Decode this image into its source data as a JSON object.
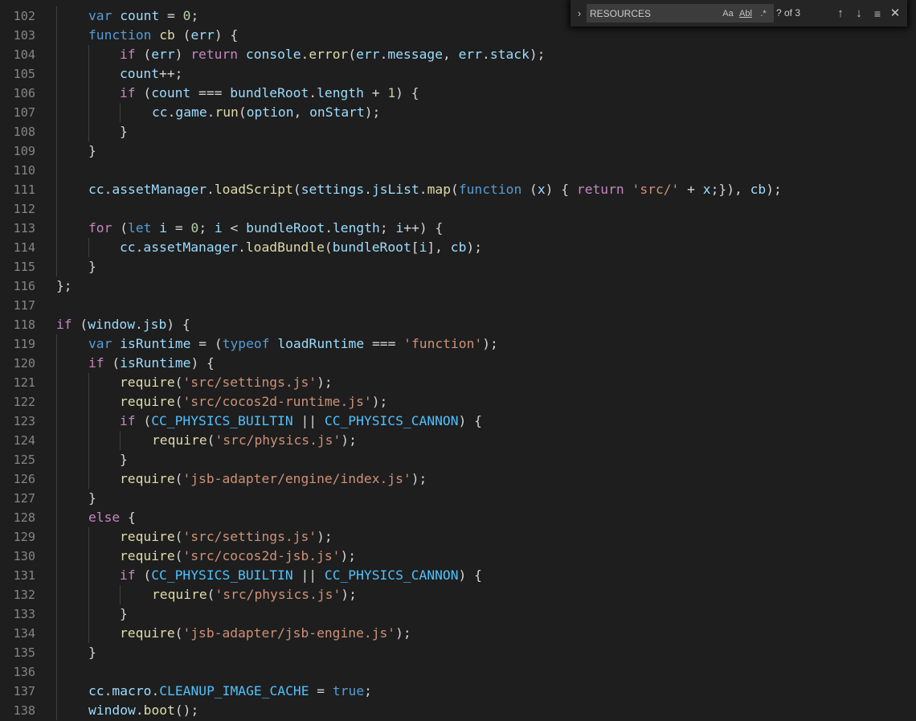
{
  "find": {
    "toggle_icon": "chevron-right",
    "query": "RESOURCES",
    "match_case_label": "Aa",
    "match_word_label": "Abl",
    "regex_label": ".*",
    "match_count": "? of 3",
    "prev_icon": "↑",
    "next_icon": "↓",
    "selection_icon": "≡",
    "close_icon": "✕"
  },
  "colors": {
    "background": "#1e1e1e",
    "keyword": "#569cd6",
    "control": "#c586c0",
    "variable": "#9cdcfe",
    "function": "#dcdcaa",
    "string": "#ce9178",
    "number": "#b5cea8",
    "constant": "#4fc1ff",
    "line_number": "#858585"
  },
  "lines": [
    {
      "n": "102",
      "indent": 1,
      "t": [
        [
          "kw",
          "var"
        ],
        [
          "pl",
          " "
        ],
        [
          "var",
          "count"
        ],
        [
          "pl",
          " = "
        ],
        [
          "num",
          "0"
        ],
        [
          "pl",
          ";"
        ]
      ]
    },
    {
      "n": "103",
      "indent": 1,
      "t": [
        [
          "kw",
          "function"
        ],
        [
          "pl",
          " "
        ],
        [
          "fn",
          "cb"
        ],
        [
          "pl",
          " ("
        ],
        [
          "var",
          "err"
        ],
        [
          "pl",
          ") {"
        ]
      ]
    },
    {
      "n": "104",
      "indent": 2,
      "t": [
        [
          "ctl",
          "if"
        ],
        [
          "pl",
          " ("
        ],
        [
          "var",
          "err"
        ],
        [
          "pl",
          ") "
        ],
        [
          "ctl",
          "return"
        ],
        [
          "pl",
          " "
        ],
        [
          "var",
          "console"
        ],
        [
          "pl",
          "."
        ],
        [
          "fn",
          "error"
        ],
        [
          "pl",
          "("
        ],
        [
          "var",
          "err"
        ],
        [
          "pl",
          "."
        ],
        [
          "var",
          "message"
        ],
        [
          "pl",
          ", "
        ],
        [
          "var",
          "err"
        ],
        [
          "pl",
          "."
        ],
        [
          "var",
          "stack"
        ],
        [
          "pl",
          ");"
        ]
      ]
    },
    {
      "n": "105",
      "indent": 2,
      "t": [
        [
          "var",
          "count"
        ],
        [
          "pl",
          "++;"
        ]
      ]
    },
    {
      "n": "106",
      "indent": 2,
      "t": [
        [
          "ctl",
          "if"
        ],
        [
          "pl",
          " ("
        ],
        [
          "var",
          "count"
        ],
        [
          "pl",
          " === "
        ],
        [
          "var",
          "bundleRoot"
        ],
        [
          "pl",
          "."
        ],
        [
          "var",
          "length"
        ],
        [
          "pl",
          " + "
        ],
        [
          "num",
          "1"
        ],
        [
          "pl",
          ") {"
        ]
      ]
    },
    {
      "n": "107",
      "indent": 3,
      "t": [
        [
          "var",
          "cc"
        ],
        [
          "pl",
          "."
        ],
        [
          "var",
          "game"
        ],
        [
          "pl",
          "."
        ],
        [
          "fn",
          "run"
        ],
        [
          "pl",
          "("
        ],
        [
          "var",
          "option"
        ],
        [
          "pl",
          ", "
        ],
        [
          "var",
          "onStart"
        ],
        [
          "pl",
          ");"
        ]
      ]
    },
    {
      "n": "108",
      "indent": 2,
      "t": [
        [
          "pl",
          "}"
        ]
      ]
    },
    {
      "n": "109",
      "indent": 1,
      "t": [
        [
          "pl",
          "}"
        ]
      ]
    },
    {
      "n": "110",
      "indent": 1,
      "t": []
    },
    {
      "n": "111",
      "indent": 1,
      "t": [
        [
          "var",
          "cc"
        ],
        [
          "pl",
          "."
        ],
        [
          "var",
          "assetManager"
        ],
        [
          "pl",
          "."
        ],
        [
          "fn",
          "loadScript"
        ],
        [
          "pl",
          "("
        ],
        [
          "var",
          "settings"
        ],
        [
          "pl",
          "."
        ],
        [
          "var",
          "jsList"
        ],
        [
          "pl",
          "."
        ],
        [
          "fn",
          "map"
        ],
        [
          "pl",
          "("
        ],
        [
          "kw",
          "function"
        ],
        [
          "pl",
          " ("
        ],
        [
          "var",
          "x"
        ],
        [
          "pl",
          ") { "
        ],
        [
          "ctl",
          "return"
        ],
        [
          "pl",
          " "
        ],
        [
          "str",
          "'src/'"
        ],
        [
          "pl",
          " + "
        ],
        [
          "var",
          "x"
        ],
        [
          "pl",
          ";}), "
        ],
        [
          "var",
          "cb"
        ],
        [
          "pl",
          ");"
        ]
      ]
    },
    {
      "n": "112",
      "indent": 1,
      "t": []
    },
    {
      "n": "113",
      "indent": 1,
      "t": [
        [
          "ctl",
          "for"
        ],
        [
          "pl",
          " ("
        ],
        [
          "kw",
          "let"
        ],
        [
          "pl",
          " "
        ],
        [
          "var",
          "i"
        ],
        [
          "pl",
          " = "
        ],
        [
          "num",
          "0"
        ],
        [
          "pl",
          "; "
        ],
        [
          "var",
          "i"
        ],
        [
          "pl",
          " < "
        ],
        [
          "var",
          "bundleRoot"
        ],
        [
          "pl",
          "."
        ],
        [
          "var",
          "length"
        ],
        [
          "pl",
          "; "
        ],
        [
          "var",
          "i"
        ],
        [
          "pl",
          "++) {"
        ]
      ]
    },
    {
      "n": "114",
      "indent": 2,
      "t": [
        [
          "var",
          "cc"
        ],
        [
          "pl",
          "."
        ],
        [
          "var",
          "assetManager"
        ],
        [
          "pl",
          "."
        ],
        [
          "fn",
          "loadBundle"
        ],
        [
          "pl",
          "("
        ],
        [
          "var",
          "bundleRoot"
        ],
        [
          "pl",
          "["
        ],
        [
          "var",
          "i"
        ],
        [
          "pl",
          "], "
        ],
        [
          "var",
          "cb"
        ],
        [
          "pl",
          ");"
        ]
      ]
    },
    {
      "n": "115",
      "indent": 1,
      "t": [
        [
          "pl",
          "}"
        ]
      ]
    },
    {
      "n": "116",
      "indent": 0,
      "t": [
        [
          "pl",
          "};"
        ]
      ]
    },
    {
      "n": "117",
      "indent": 0,
      "t": []
    },
    {
      "n": "118",
      "indent": 0,
      "t": [
        [
          "ctl",
          "if"
        ],
        [
          "pl",
          " ("
        ],
        [
          "var",
          "window"
        ],
        [
          "pl",
          "."
        ],
        [
          "var",
          "jsb"
        ],
        [
          "pl",
          ") {"
        ]
      ]
    },
    {
      "n": "119",
      "indent": 1,
      "t": [
        [
          "kw",
          "var"
        ],
        [
          "pl",
          " "
        ],
        [
          "var",
          "isRuntime"
        ],
        [
          "pl",
          " = ("
        ],
        [
          "kw",
          "typeof"
        ],
        [
          "pl",
          " "
        ],
        [
          "var",
          "loadRuntime"
        ],
        [
          "pl",
          " === "
        ],
        [
          "str",
          "'function'"
        ],
        [
          "pl",
          ");"
        ]
      ]
    },
    {
      "n": "120",
      "indent": 1,
      "t": [
        [
          "ctl",
          "if"
        ],
        [
          "pl",
          " ("
        ],
        [
          "var",
          "isRuntime"
        ],
        [
          "pl",
          ") {"
        ]
      ]
    },
    {
      "n": "121",
      "indent": 2,
      "t": [
        [
          "fn",
          "require"
        ],
        [
          "pl",
          "("
        ],
        [
          "str",
          "'src/settings.js'"
        ],
        [
          "pl",
          ");"
        ]
      ]
    },
    {
      "n": "122",
      "indent": 2,
      "t": [
        [
          "fn",
          "require"
        ],
        [
          "pl",
          "("
        ],
        [
          "str",
          "'src/cocos2d-runtime.js'"
        ],
        [
          "pl",
          ");"
        ]
      ]
    },
    {
      "n": "123",
      "indent": 2,
      "t": [
        [
          "ctl",
          "if"
        ],
        [
          "pl",
          " ("
        ],
        [
          "const",
          "CC_PHYSICS_BUILTIN"
        ],
        [
          "pl",
          " || "
        ],
        [
          "const",
          "CC_PHYSICS_CANNON"
        ],
        [
          "pl",
          ") {"
        ]
      ]
    },
    {
      "n": "124",
      "indent": 3,
      "t": [
        [
          "fn",
          "require"
        ],
        [
          "pl",
          "("
        ],
        [
          "str",
          "'src/physics.js'"
        ],
        [
          "pl",
          ");"
        ]
      ]
    },
    {
      "n": "125",
      "indent": 2,
      "t": [
        [
          "pl",
          "}"
        ]
      ]
    },
    {
      "n": "126",
      "indent": 2,
      "t": [
        [
          "fn",
          "require"
        ],
        [
          "pl",
          "("
        ],
        [
          "str",
          "'jsb-adapter/engine/index.js'"
        ],
        [
          "pl",
          ");"
        ]
      ]
    },
    {
      "n": "127",
      "indent": 1,
      "t": [
        [
          "pl",
          "}"
        ]
      ]
    },
    {
      "n": "128",
      "indent": 1,
      "t": [
        [
          "ctl",
          "else"
        ],
        [
          "pl",
          " {"
        ]
      ]
    },
    {
      "n": "129",
      "indent": 2,
      "t": [
        [
          "fn",
          "require"
        ],
        [
          "pl",
          "("
        ],
        [
          "str",
          "'src/settings.js'"
        ],
        [
          "pl",
          ");"
        ]
      ]
    },
    {
      "n": "130",
      "indent": 2,
      "t": [
        [
          "fn",
          "require"
        ],
        [
          "pl",
          "("
        ],
        [
          "str",
          "'src/cocos2d-jsb.js'"
        ],
        [
          "pl",
          ");"
        ]
      ]
    },
    {
      "n": "131",
      "indent": 2,
      "t": [
        [
          "ctl",
          "if"
        ],
        [
          "pl",
          " ("
        ],
        [
          "const",
          "CC_PHYSICS_BUILTIN"
        ],
        [
          "pl",
          " || "
        ],
        [
          "const",
          "CC_PHYSICS_CANNON"
        ],
        [
          "pl",
          ") {"
        ]
      ]
    },
    {
      "n": "132",
      "indent": 3,
      "t": [
        [
          "fn",
          "require"
        ],
        [
          "pl",
          "("
        ],
        [
          "str",
          "'src/physics.js'"
        ],
        [
          "pl",
          ");"
        ]
      ]
    },
    {
      "n": "133",
      "indent": 2,
      "t": [
        [
          "pl",
          "}"
        ]
      ]
    },
    {
      "n": "134",
      "indent": 2,
      "t": [
        [
          "fn",
          "require"
        ],
        [
          "pl",
          "("
        ],
        [
          "str",
          "'jsb-adapter/jsb-engine.js'"
        ],
        [
          "pl",
          ");"
        ]
      ]
    },
    {
      "n": "135",
      "indent": 1,
      "t": [
        [
          "pl",
          "}"
        ]
      ]
    },
    {
      "n": "136",
      "indent": 1,
      "t": []
    },
    {
      "n": "137",
      "indent": 1,
      "t": [
        [
          "var",
          "cc"
        ],
        [
          "pl",
          "."
        ],
        [
          "var",
          "macro"
        ],
        [
          "pl",
          "."
        ],
        [
          "const",
          "CLEANUP_IMAGE_CACHE"
        ],
        [
          "pl",
          " = "
        ],
        [
          "kw",
          "true"
        ],
        [
          "pl",
          ";"
        ]
      ]
    },
    {
      "n": "138",
      "indent": 1,
      "t": [
        [
          "var",
          "window"
        ],
        [
          "pl",
          "."
        ],
        [
          "fn",
          "boot"
        ],
        [
          "pl",
          "();"
        ]
      ]
    }
  ]
}
